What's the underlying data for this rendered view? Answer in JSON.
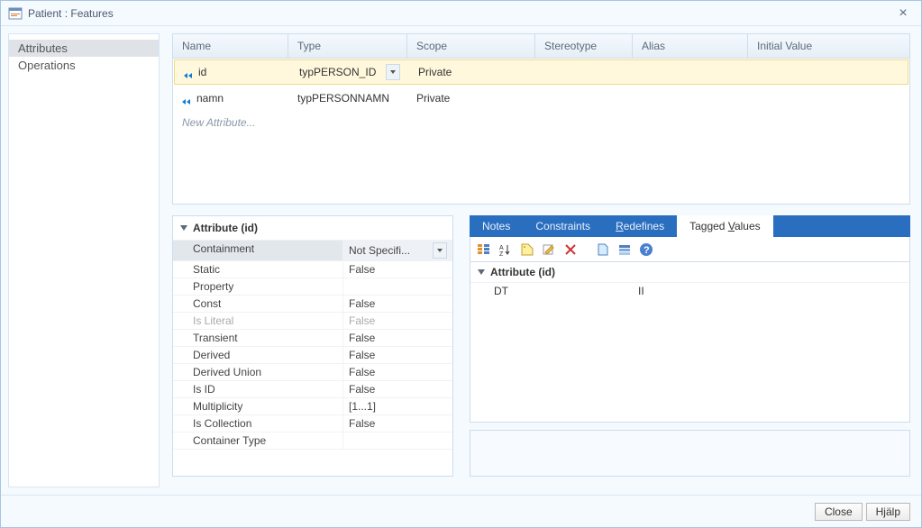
{
  "window": {
    "title": "Patient : Features"
  },
  "sidebar": {
    "items": [
      {
        "label": "Attributes",
        "active": true
      },
      {
        "label": "Operations",
        "active": false
      }
    ]
  },
  "grid": {
    "columns": [
      "Name",
      "Type",
      "Scope",
      "Stereotype",
      "Alias",
      "Initial Value"
    ],
    "rows": [
      {
        "name": "id",
        "type": "typPERSON_ID",
        "scope": "Private",
        "stereotype": "",
        "alias": "",
        "initial": "",
        "selected": true
      },
      {
        "name": "namn",
        "type": "typPERSONNAMN",
        "scope": "Private",
        "stereotype": "",
        "alias": "",
        "initial": "",
        "selected": false
      }
    ],
    "new_placeholder": "New Attribute..."
  },
  "propgrid": {
    "title": "Attribute (id)",
    "rows": [
      {
        "key": "Containment",
        "val": "Not Specifi...",
        "selected": true,
        "dropdown": true
      },
      {
        "key": "Static",
        "val": "False"
      },
      {
        "key": "Property",
        "val": ""
      },
      {
        "key": "Const",
        "val": "False"
      },
      {
        "key": "Is Literal",
        "val": "False",
        "disabled": true
      },
      {
        "key": "Transient",
        "val": "False"
      },
      {
        "key": "Derived",
        "val": "False"
      },
      {
        "key": "Derived Union",
        "val": "False"
      },
      {
        "key": "Is ID",
        "val": "False"
      },
      {
        "key": "Multiplicity",
        "val": "[1...1]"
      },
      {
        "key": "Is Collection",
        "val": "False"
      },
      {
        "key": "Container Type",
        "val": ""
      }
    ]
  },
  "tabs": {
    "items": [
      "Notes",
      "Constraints",
      "Redefines",
      "Tagged Values"
    ],
    "active": 3
  },
  "tagged_values": {
    "group": "Attribute (id)",
    "rows": [
      {
        "key": "DT",
        "val": "II"
      }
    ]
  },
  "footer": {
    "close": "Close",
    "help": "Hjälp"
  },
  "icons": {
    "app": "app-icon",
    "close": "×"
  }
}
